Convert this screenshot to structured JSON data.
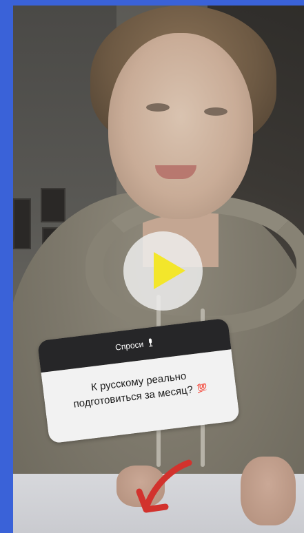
{
  "sticker": {
    "header_label": "Спроси",
    "header_icon": "microphone-icon",
    "question_line1": "К русскому реально",
    "question_line2": "подготовиться за месяц?",
    "emoji": "💯"
  },
  "player": {
    "play_icon": "play-icon"
  },
  "colors": {
    "frame_border": "#3a62d8",
    "play_triangle": "#f3e62b",
    "sticker_header": "#262628",
    "sticker_body": "#f2f2f2",
    "arrow": "#d2322d"
  }
}
